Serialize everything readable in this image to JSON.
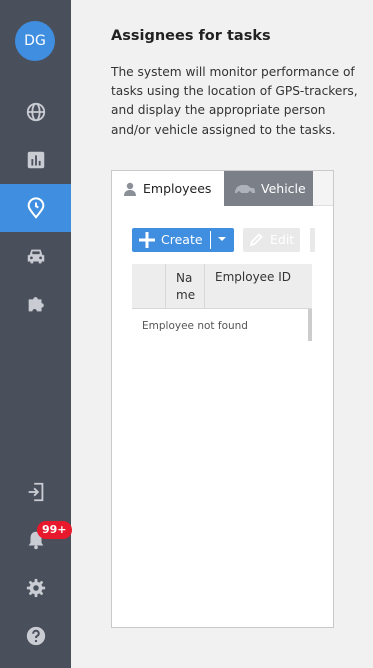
{
  "user": {
    "initials": "DG"
  },
  "sidebar": {
    "items": [
      {
        "icon": "globe-icon"
      },
      {
        "icon": "bar-chart-icon"
      },
      {
        "icon": "location-clock-icon",
        "active": true
      },
      {
        "icon": "car-icon"
      },
      {
        "icon": "puzzle-icon"
      },
      {
        "icon": "logout-icon"
      },
      {
        "icon": "bell-icon"
      },
      {
        "icon": "gear-icon"
      },
      {
        "icon": "help-icon"
      }
    ],
    "notification_count": "99+"
  },
  "page": {
    "title": "Assignees for tasks",
    "description": "The system will monitor performance of tasks using the location of GPS-trackers, and display the appropriate person and/or vehicle assigned to the tasks."
  },
  "tabs": [
    {
      "label": "Employees",
      "icon": "person-icon",
      "active": true
    },
    {
      "label": "Vehicle",
      "icon": "car-icon",
      "active": false
    }
  ],
  "toolbar": {
    "create_label": "Create",
    "edit_label": "Edit"
  },
  "table": {
    "columns": [
      "Na me",
      "Employee ID"
    ],
    "empty_message": "Employee not found"
  },
  "colors": {
    "sidebar_bg": "#4a4f5c",
    "accent": "#3f8ee0",
    "badge": "#e8192c"
  }
}
